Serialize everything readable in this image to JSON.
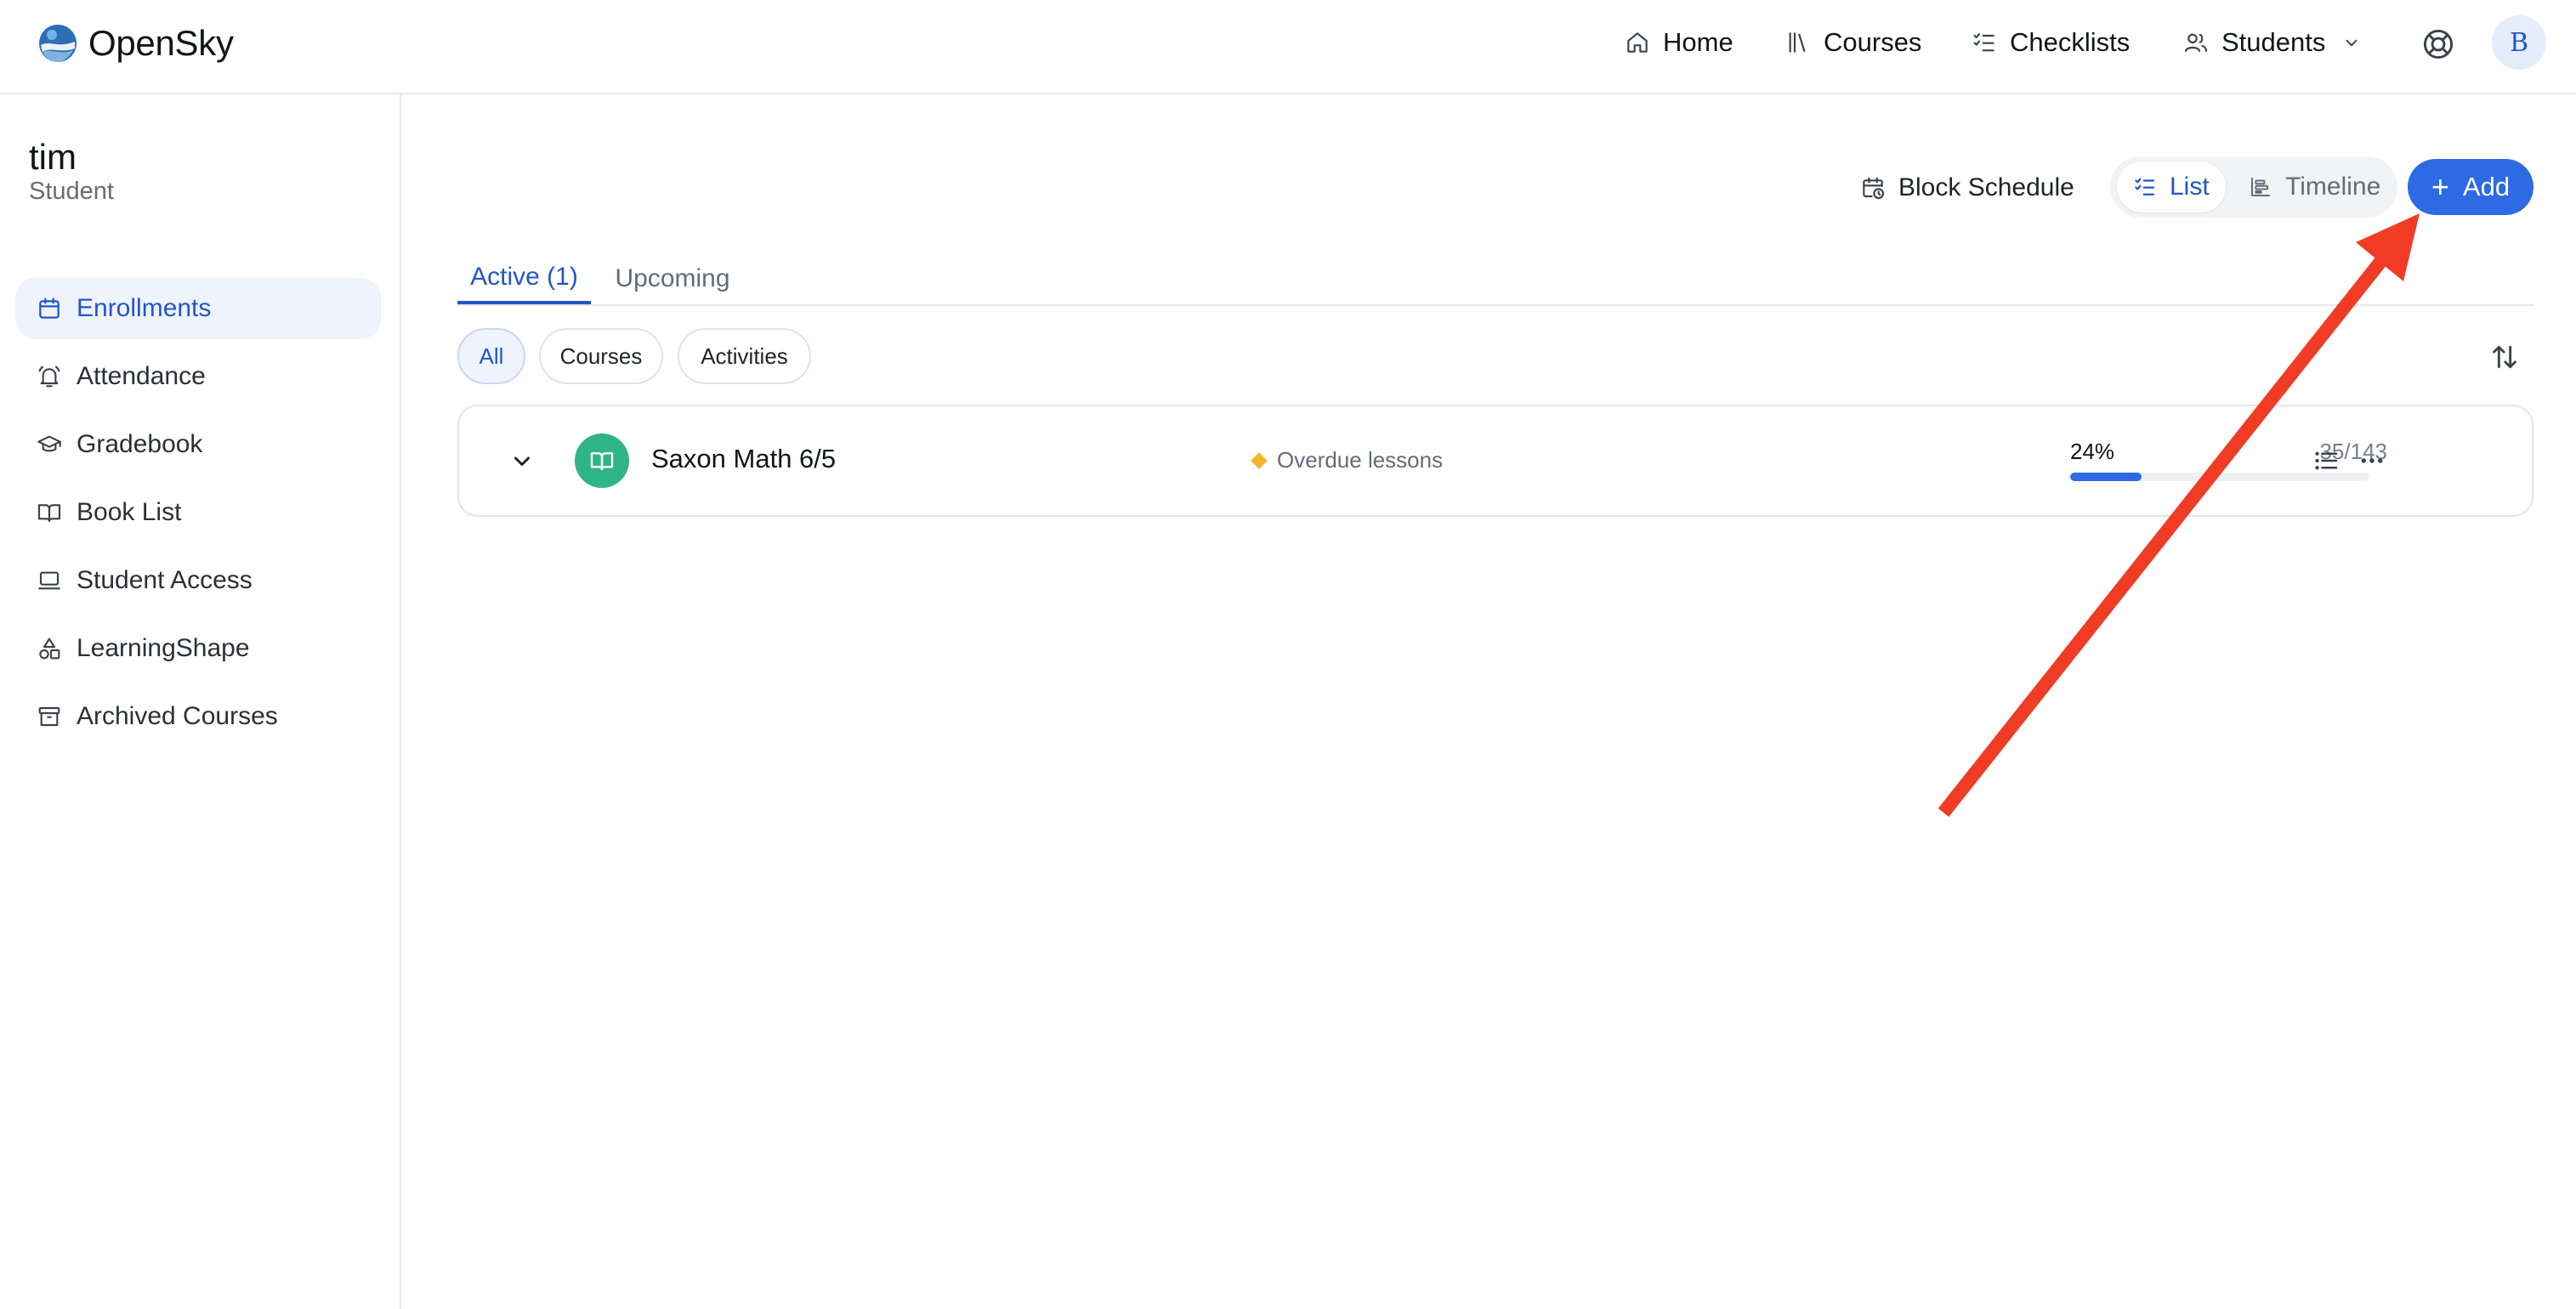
{
  "app": {
    "brand": "OpenSky"
  },
  "nav": {
    "home": "Home",
    "courses": "Courses",
    "checklists": "Checklists",
    "students": "Students",
    "avatar_initial": "B"
  },
  "student": {
    "name": "tim",
    "role": "Student"
  },
  "sidebar": {
    "items": [
      {
        "label": "Enrollments",
        "icon": "calendar-icon",
        "active": true
      },
      {
        "label": "Attendance",
        "icon": "bell-icon"
      },
      {
        "label": "Gradebook",
        "icon": "graduation-cap-icon"
      },
      {
        "label": "Book List",
        "icon": "open-book-icon"
      },
      {
        "label": "Student Access",
        "icon": "laptop-icon"
      },
      {
        "label": "LearningShape",
        "icon": "shapes-icon"
      },
      {
        "label": "Archived Courses",
        "icon": "archive-icon"
      }
    ]
  },
  "toolbar": {
    "block_schedule": "Block Schedule",
    "list": "List",
    "timeline": "Timeline",
    "add": "Add"
  },
  "tabs": {
    "active": "Active (1)",
    "upcoming": "Upcoming"
  },
  "filters": {
    "all": "All",
    "courses": "Courses",
    "activities": "Activities"
  },
  "enrollments": [
    {
      "course": "Saxon Math 6/5",
      "status": "Overdue lessons",
      "progress_label": "24%",
      "progress_fraction": 0.24,
      "lessons": "35/143"
    }
  ],
  "colors": {
    "accent": "#2d6ae3",
    "active_text": "#2455c8",
    "course_icon": "#2fb488",
    "overdue": "#f2b72d",
    "annotation_arrow": "#f03c24"
  }
}
